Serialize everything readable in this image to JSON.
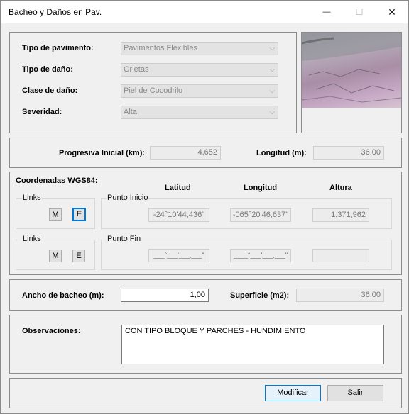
{
  "window": {
    "title": "Bacheo y Daños en Pav.",
    "min": "—",
    "max": "☐",
    "close": "✕"
  },
  "pavimento": {
    "tipo_pav_label": "Tipo de pavimento:",
    "tipo_pav_value": "Pavimentos Flexibles",
    "tipo_dano_label": "Tipo de daño:",
    "tipo_dano_value": "Grietas",
    "clase_dano_label": "Clase de daño:",
    "clase_dano_value": "Piel de Cocodrilo",
    "severidad_label": "Severidad:",
    "severidad_value": "Alta",
    "arrow": "⌵"
  },
  "progresiva": {
    "label": "Progresiva Inicial (km):",
    "value": "4,652",
    "longitud_label": "Longitud (m):",
    "longitud_value": "36,00"
  },
  "coords": {
    "title": "Coordenadas WGS84:",
    "col_latitud": "Latitud",
    "col_longitud": "Longitud",
    "col_altura": "Altura",
    "links_label": "Links",
    "btn_m": "M",
    "btn_e": "E",
    "punto_inicio_label": "Punto Inicio",
    "inicio_lat": "-24°10'44,436\"",
    "inicio_lon": "-065°20'46,637\"",
    "inicio_alt": "1.371,962",
    "punto_fin_label": "Punto Fin",
    "fin_lat": "___°___'___,___\"",
    "fin_lon": "____°___'___,___\"",
    "fin_alt": ""
  },
  "bacheo": {
    "ancho_label": "Ancho de bacheo (m):",
    "ancho_value": "1,00",
    "superficie_label": "Superficie (m2):",
    "superficie_value": "36,00"
  },
  "observaciones": {
    "label": "Observaciones:",
    "value": "CON TIPO BLOQUE Y PARCHES - HUNDIMIENTO"
  },
  "actions": {
    "modificar": "Modificar",
    "salir": "Salir"
  },
  "colors": {
    "accent": "#0078d7",
    "window_bg": "#f0f0f0"
  }
}
